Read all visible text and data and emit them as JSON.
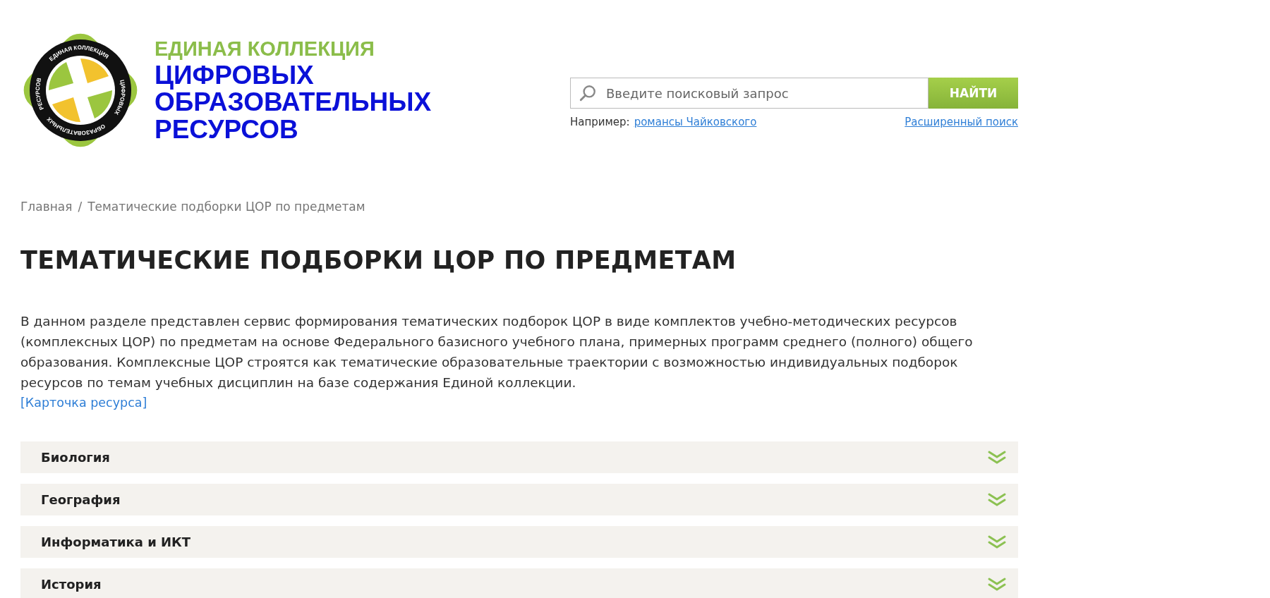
{
  "logo": {
    "ring_texts": [
      "ЕДИНАЯ КОЛЛЕКЦИЯ",
      "ЦИФРОВЫХ",
      "ОБРАЗОВАТЕЛЬНЫХ",
      "РЕСУРСОВ"
    ],
    "line_1": "ЕДИНАЯ КОЛЛЕКЦИЯ",
    "line_2": "ЦИФРОВЫХ",
    "line_3": "ОБРАЗОВАТЕЛЬНЫХ",
    "line_4": "РЕСУРСОВ"
  },
  "search": {
    "placeholder": "Введите поисковый запрос",
    "button": "НАЙТИ",
    "example_label": "Например:",
    "example_link": "романсы Чайковского",
    "advanced_link": "Расширенный поиск"
  },
  "breadcrumbs": [
    {
      "label": "Главная"
    },
    {
      "label": "Тематические подборки ЦОР по предметам"
    }
  ],
  "breadcrumb_separator": "/",
  "title": "ТЕМАТИЧЕСКИЕ ПОДБОРКИ ЦОР ПО ПРЕДМЕТАМ",
  "description": "В данном разделе представлен сервис формирования тематических подборок ЦОР в виде комплектов учебно-методических ресурсов (комплексных ЦОР) по предметам на основе Федерального базисного учебного плана, примерных программ среднего (полного) общего образования. Комплексные ЦОР строятся как тематические образовательные траектории с возможностью индивидуальных подборок ресурсов по темам учебных дисциплин на базе содержания Единой коллекции.",
  "resource_card_link": "[Карточка ресурса]",
  "subjects": [
    {
      "label": "Биология",
      "expanded": false
    },
    {
      "label": "География",
      "expanded": false
    },
    {
      "label": "Информатика и ИКТ",
      "expanded": false
    },
    {
      "label": "История",
      "expanded": false
    }
  ]
}
